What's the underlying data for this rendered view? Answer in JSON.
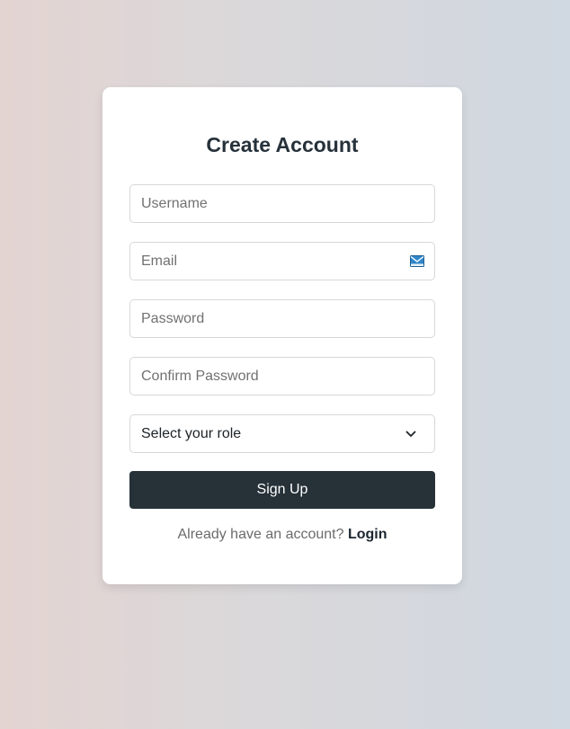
{
  "form": {
    "title": "Create Account",
    "fields": {
      "username": {
        "placeholder": "Username",
        "value": ""
      },
      "email": {
        "placeholder": "Email",
        "value": "",
        "icon": "mail-icon"
      },
      "password": {
        "placeholder": "Password",
        "value": ""
      },
      "confirm_password": {
        "placeholder": "Confirm Password",
        "value": ""
      }
    },
    "role_select": {
      "selected": "Select your role",
      "icon": "chevron-down-icon"
    },
    "submit_label": "Sign Up",
    "footer": {
      "prompt": "Already have an account?",
      "link_label": "Login"
    }
  },
  "colors": {
    "primary": "#263138",
    "card_bg": "#ffffff",
    "input_border": "#d7d7d7",
    "background_left": "#e3d4d1",
    "background_right": "#d0d8e1"
  }
}
